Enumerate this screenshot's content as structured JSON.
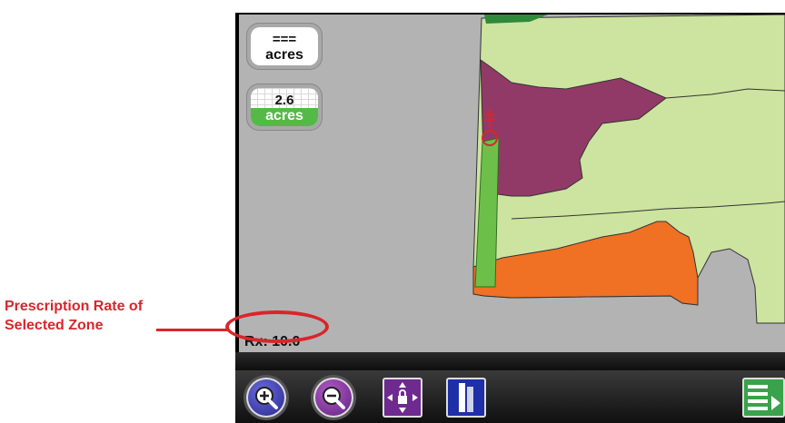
{
  "status": {
    "total_area_value": "===",
    "total_area_unit": "acres",
    "applied_area_value": "2.6",
    "applied_area_unit": "acres",
    "rx_rate": "Rx: 10.0"
  },
  "callout": {
    "line1": "Prescription Rate of",
    "line2": "Selected Zone"
  },
  "toolbar": {
    "buttons": [
      {
        "name": "zoom-in",
        "icon": "magnifier-plus"
      },
      {
        "name": "zoom-out",
        "icon": "magnifier-minus"
      },
      {
        "name": "pan-lock",
        "icon": "move-arrows-lock"
      },
      {
        "name": "guidance-toggle",
        "icon": "swath-bars"
      },
      {
        "name": "menu",
        "icon": "list-menu"
      }
    ]
  },
  "colors": {
    "zone_light_green": "#cde3a0",
    "zone_purple": "#923a67",
    "zone_orange": "#f07024",
    "coverage_green": "#6cc04a",
    "dark_green_edge": "#2e8a3a",
    "map_background": "#b3b3b4",
    "callout_red": "#d8262b"
  }
}
